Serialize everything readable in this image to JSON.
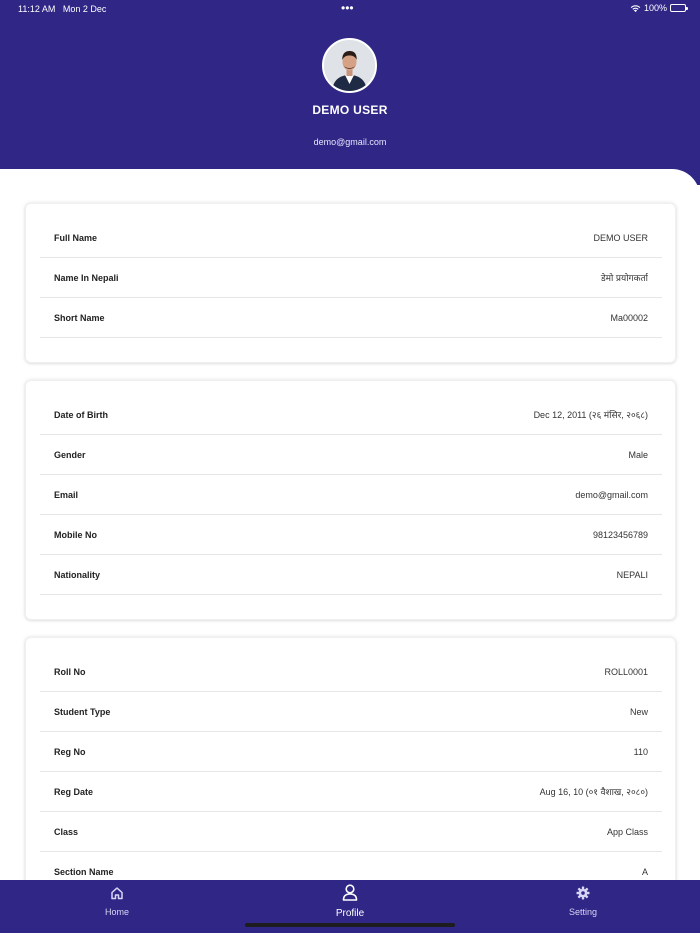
{
  "status_bar": {
    "time": "11:12 AM",
    "date": "Mon 2 Dec",
    "battery": "100%",
    "more_dots": "•••"
  },
  "profile": {
    "name": "DEMO USER",
    "email": "demo@gmail.com"
  },
  "cards": [
    {
      "rows": [
        {
          "label": "Full Name",
          "value": "DEMO USER"
        },
        {
          "label": "Name In Nepali",
          "value": "डेमो प्रयोगकर्ता"
        },
        {
          "label": "Short Name",
          "value": "Ma00002"
        }
      ]
    },
    {
      "rows": [
        {
          "label": "Date of Birth",
          "value": "Dec 12, 2011 (२६ मंसिर, २०६८)"
        },
        {
          "label": "Gender",
          "value": "Male"
        },
        {
          "label": "Email",
          "value": "demo@gmail.com"
        },
        {
          "label": "Mobile No",
          "value": "98123456789"
        },
        {
          "label": "Nationality",
          "value": "NEPALI"
        }
      ]
    },
    {
      "rows": [
        {
          "label": "Roll No",
          "value": "ROLL0001"
        },
        {
          "label": "Student Type",
          "value": "New"
        },
        {
          "label": "Reg No",
          "value": "110"
        },
        {
          "label": "Reg Date",
          "value": "Aug 16, 10 (०१ वैशाख, २०८०)"
        },
        {
          "label": "Class",
          "value": "App Class"
        },
        {
          "label": "Section Name",
          "value": "A"
        }
      ]
    }
  ],
  "bottom_nav": [
    {
      "label": "Home",
      "icon": "home-icon",
      "active": false
    },
    {
      "label": "Profile",
      "icon": "user-icon",
      "active": true
    },
    {
      "label": "Setting",
      "icon": "gear-icon",
      "active": false
    }
  ],
  "colors": {
    "primary": "#2f2686",
    "background": "#ffffff",
    "divider": "#e6e6e6"
  }
}
